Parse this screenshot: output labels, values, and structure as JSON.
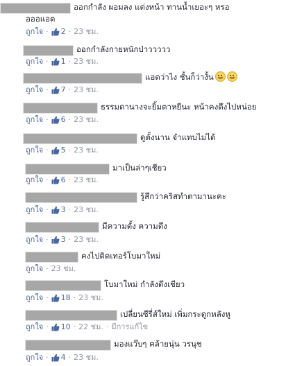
{
  "ui": {
    "like_label": "ถูกใจ",
    "dot": "·",
    "edited_label": "มีการแก้ไข"
  },
  "comments": [
    {
      "text": "ออกกำลัง ผอมลง แต่งหน้า ทานน้ำเยอะๆ หรอ",
      "text2": "อออแอด",
      "likes": "2",
      "time": "23 ชม."
    },
    {
      "text": "ออกกำลังกายหนักป่าววววว",
      "likes": "1",
      "time": "23 ชม."
    },
    {
      "text": "แอดว่าไง ชั้นก็ว่างั้น",
      "emoji": "grin-icon",
      "likes": "7",
      "time": "23 ชม."
    },
    {
      "text": "ธรรมดานางจะยิ้มตาหยีนะ หน้าคงดึงไปหน่อย",
      "likes": "6",
      "time": "23 ชม."
    },
    {
      "text": "ดูตั้งนาน จำแทบไม่ได้",
      "likes": "5",
      "time": "23 ชม."
    },
    {
      "text": "มาเป็นล่าๆเชียว",
      "likes": "6",
      "time": "23 ชม."
    },
    {
      "text": "รู้สึกว่าคริสทำตามานะคะ",
      "likes": "3",
      "time": "23 ชม."
    },
    {
      "text": "มีความตั้ง ความตึง",
      "likes": "3",
      "time": "23 ชม."
    },
    {
      "text": "คงไปติดเทอร์โบมาใหม่",
      "time": "23 ชม."
    },
    {
      "text": "โบมาใหม่ กำลังดึงเชียว",
      "likes": "18",
      "time": "23 ชม."
    },
    {
      "text": "เปลี่ยนซีรี่ส์ใหม่ เพิ่มกระดูกหลังหู",
      "likes": "10",
      "time": "22 ชม.",
      "edited": true
    },
    {
      "text": "มองแว๊บๆ คล้ายนุ่น วรนุช",
      "likes": "4",
      "time": "23 ชม."
    }
  ]
}
